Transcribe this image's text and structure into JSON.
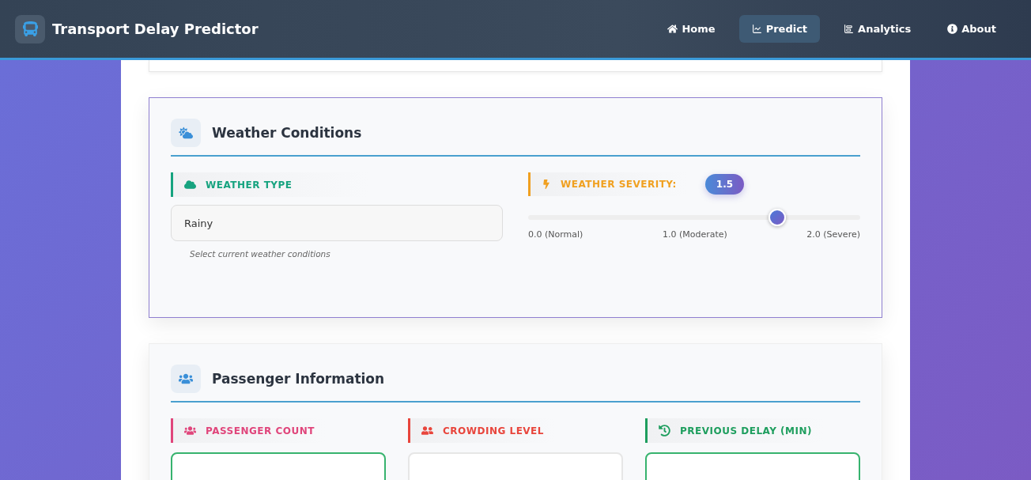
{
  "header": {
    "title": "Transport Delay Predictor",
    "nav": [
      {
        "label": "Home",
        "selected": false
      },
      {
        "label": "Predict",
        "selected": true
      },
      {
        "label": "Analytics",
        "selected": false
      },
      {
        "label": "About",
        "selected": false
      }
    ]
  },
  "weather": {
    "title": "Weather Conditions",
    "type_field": {
      "label": "WEATHER TYPE",
      "color": "#16a37f",
      "value": "Rainy",
      "hint": "Select current weather conditions"
    },
    "severity": {
      "label": "WEATHER SEVERITY:",
      "color": "#f0a020",
      "reading": "1.5",
      "level": 0.75,
      "ticks": [
        "0.0 (Normal)",
        "1.0 (Moderate)",
        "2.0 (Severe)"
      ]
    }
  },
  "passenger": {
    "title": "Passenger Information",
    "fields": [
      {
        "label": "PASSENGER COUNT",
        "color": "#e0457b",
        "valid": true
      },
      {
        "label": "CROWDING LEVEL",
        "color": "#e8453c",
        "valid": false
      },
      {
        "label": "PREVIOUS DELAY (MIN)",
        "color": "#1e9e5e",
        "valid": true
      }
    ]
  }
}
